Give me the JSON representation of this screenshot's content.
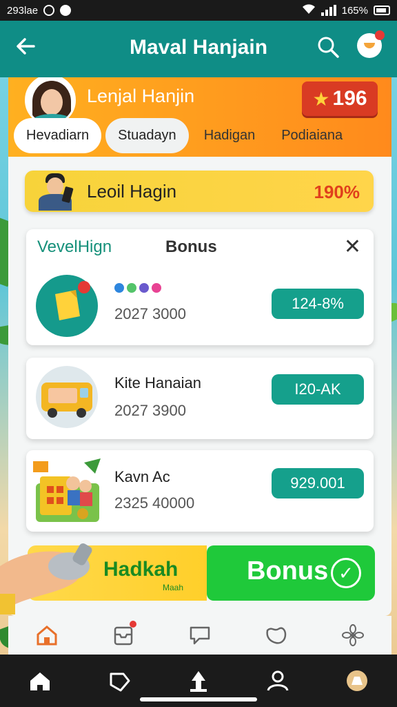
{
  "status_bar": {
    "time": "293lae",
    "battery_pct": "165%"
  },
  "app_bar": {
    "title": "Maval Hanjain"
  },
  "profile": {
    "name": "Lenjal Hanjin",
    "score": "196"
  },
  "tabs": [
    {
      "label": "Hevadiarn",
      "active": true
    },
    {
      "label": "Stuadayn",
      "active": false
    },
    {
      "label": "Hadigan",
      "active": false
    },
    {
      "label": "Podiaiana",
      "active": false
    }
  ],
  "level": {
    "label": "Leoil Hagin",
    "percent": "190%"
  },
  "bonus_card": {
    "brand": "VevelHign",
    "heading": "Bonus",
    "item": {
      "sub": "2027 3000",
      "pill": "124-8%"
    }
  },
  "items": [
    {
      "title": "Kite Hanaian",
      "sub": "2027 3900",
      "pill": "I20-AK"
    },
    {
      "title": "Kavn Ac",
      "sub": "2325 40000",
      "pill": "929.001"
    }
  ],
  "bottom_bonus": {
    "left_label": "Hadkah",
    "left_small": "Maah",
    "right_label": "Bonus"
  },
  "colors": {
    "teal": "#0f8d86",
    "orange": "#ff8a1c",
    "green": "#1fc93a",
    "red": "#d93b23"
  }
}
